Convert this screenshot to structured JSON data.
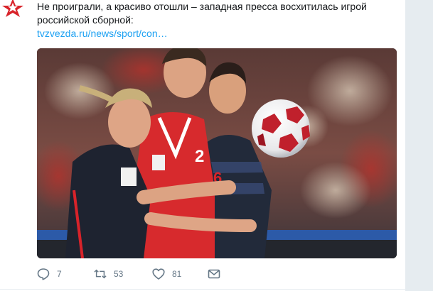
{
  "tweet": {
    "text_line1": "Не проиграли, а красиво отошли – западная пресса восхитилась игрой",
    "text_line2": "российской сборной:",
    "link": "tvzvezda.ru/news/sport/con…"
  },
  "media": {
    "alt": "Football players with ball"
  },
  "actions": {
    "reply_count": "7",
    "retweet_count": "53",
    "like_count": "81"
  },
  "colors": {
    "link": "#1da1f2",
    "avatar_star": "#d8232a",
    "icon": "#657786"
  },
  "icons": {
    "reply": "reply-icon",
    "retweet": "retweet-icon",
    "like": "heart-icon",
    "message": "envelope-icon",
    "avatar": "red-star-logo"
  }
}
